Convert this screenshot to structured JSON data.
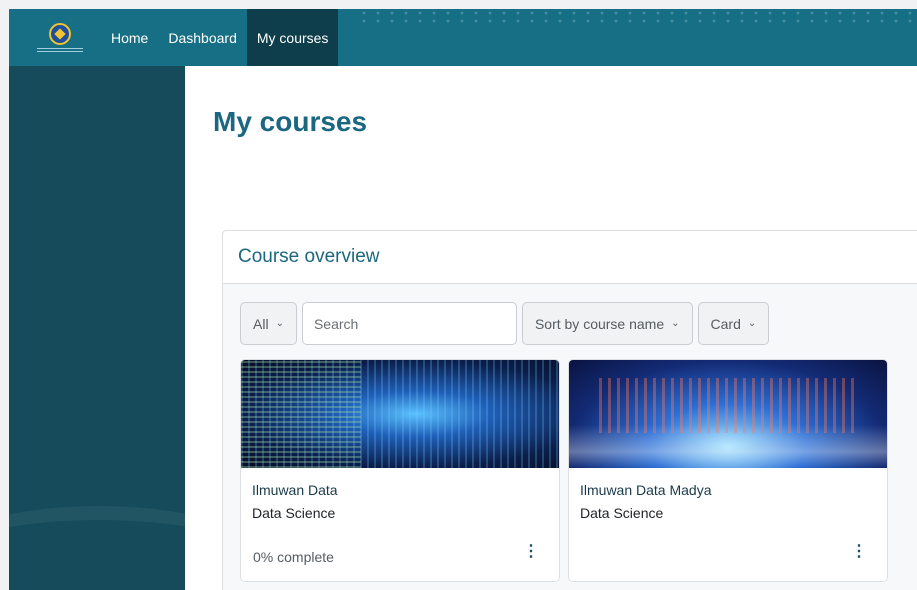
{
  "navbar": {
    "items": [
      {
        "label": "Home"
      },
      {
        "label": "Dashboard"
      },
      {
        "label": "My courses"
      }
    ]
  },
  "page": {
    "title": "My courses"
  },
  "overview": {
    "title": "Course overview",
    "filters": {
      "grouping": "All",
      "search_placeholder": "Search",
      "sort": "Sort by course name",
      "view": "Card"
    },
    "courses": [
      {
        "name": "Ilmuwan Data",
        "category": "Data Science",
        "progress_text": "0% complete"
      },
      {
        "name": "Ilmuwan Data Madya",
        "category": "Data Science",
        "progress_text": ""
      }
    ]
  },
  "colors": {
    "navbar": "#166f84",
    "nav_active": "#0e3e4c",
    "sidebar": "#154b5b",
    "accent_text": "#1b6680"
  },
  "icons": {
    "logo": "institution-logo",
    "dropdown": "chevron-down-icon",
    "course_menu": "vertical-ellipsis-icon"
  }
}
